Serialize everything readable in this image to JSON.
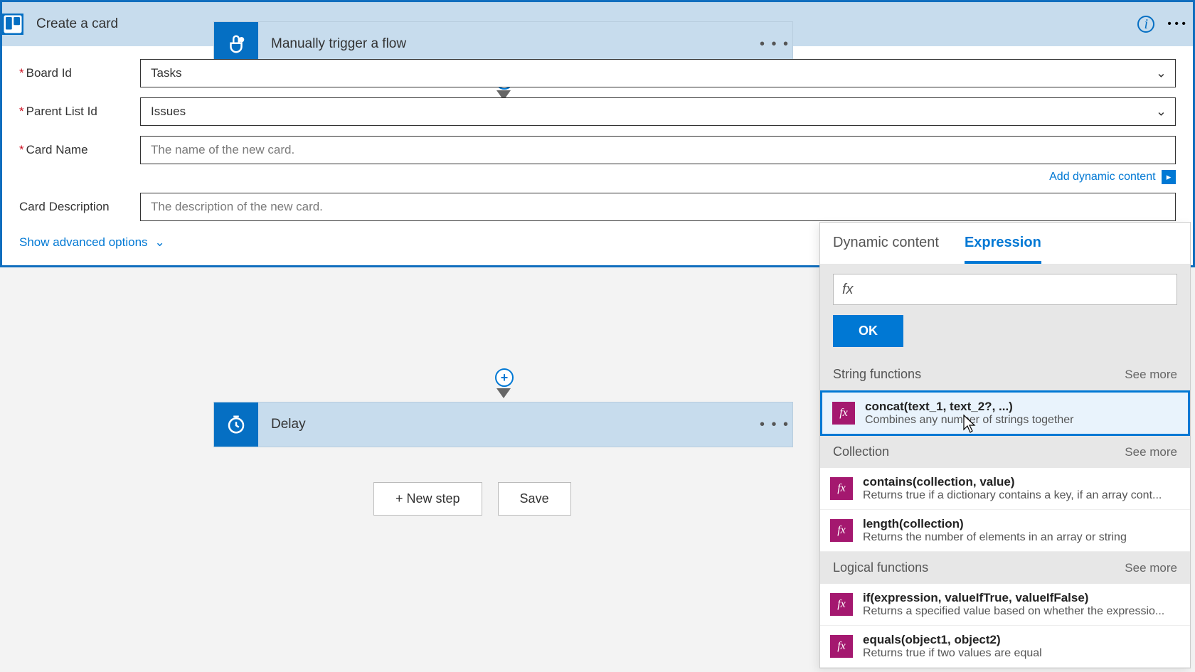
{
  "trigger": {
    "title": "Manually trigger a flow"
  },
  "create_card": {
    "title": "Create a card",
    "fields": {
      "board_label": "Board Id",
      "board_value": "Tasks",
      "list_label": "Parent List Id",
      "list_value": "Issues",
      "name_label": "Card Name",
      "name_placeholder": "The name of the new card.",
      "desc_label": "Card Description",
      "desc_placeholder": "The description of the new card."
    },
    "add_dynamic": "Add dynamic content",
    "advanced": "Show advanced options"
  },
  "delay": {
    "title": "Delay"
  },
  "buttons": {
    "new_step": "+ New step",
    "save": "Save"
  },
  "panel": {
    "tab_dynamic": "Dynamic content",
    "tab_expression": "Expression",
    "fx_prefix": "fx",
    "ok": "OK",
    "see_more": "See more",
    "cats": {
      "string": "String functions",
      "collection": "Collection",
      "logical": "Logical functions"
    },
    "fns": {
      "concat_sig": "concat(text_1, text_2?, ...)",
      "concat_desc": "Combines any number of strings together",
      "contains_sig": "contains(collection, value)",
      "contains_desc": "Returns true if a dictionary contains a key, if an array cont...",
      "length_sig": "length(collection)",
      "length_desc": "Returns the number of elements in an array or string",
      "if_sig": "if(expression, valueIfTrue, valueIfFalse)",
      "if_desc": "Returns a specified value based on whether the expressio...",
      "equals_sig": "equals(object1, object2)",
      "equals_desc": "Returns true if two values are equal"
    }
  }
}
